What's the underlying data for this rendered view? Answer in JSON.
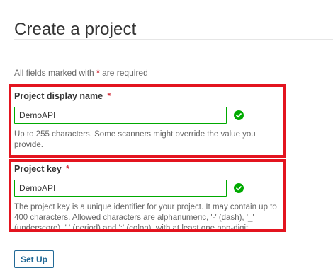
{
  "page": {
    "title": "Create a project"
  },
  "form": {
    "required_note_prefix": "All fields marked with",
    "required_marker": "*",
    "required_note_suffix": "are required",
    "display_name": {
      "label": "Project display name",
      "value": "DemoAPI",
      "help": "Up to 255 characters. Some scanners might override the value you provide."
    },
    "project_key": {
      "label": "Project key",
      "value": "DemoAPI",
      "help": "The project key is a unique identifier for your project. It may contain up to 400 characters. Allowed characters are alphanumeric, '-' (dash), '_' (underscore), '.' (period) and ':' (colon), with at least one non-digit."
    },
    "submit_label": "Set Up"
  },
  "colors": {
    "valid_green": "#00aa00",
    "required_red": "#d4333f",
    "annotation_red": "#e3141f",
    "button_blue": "#236a97"
  },
  "icons": {
    "valid": "check-circle-icon"
  }
}
